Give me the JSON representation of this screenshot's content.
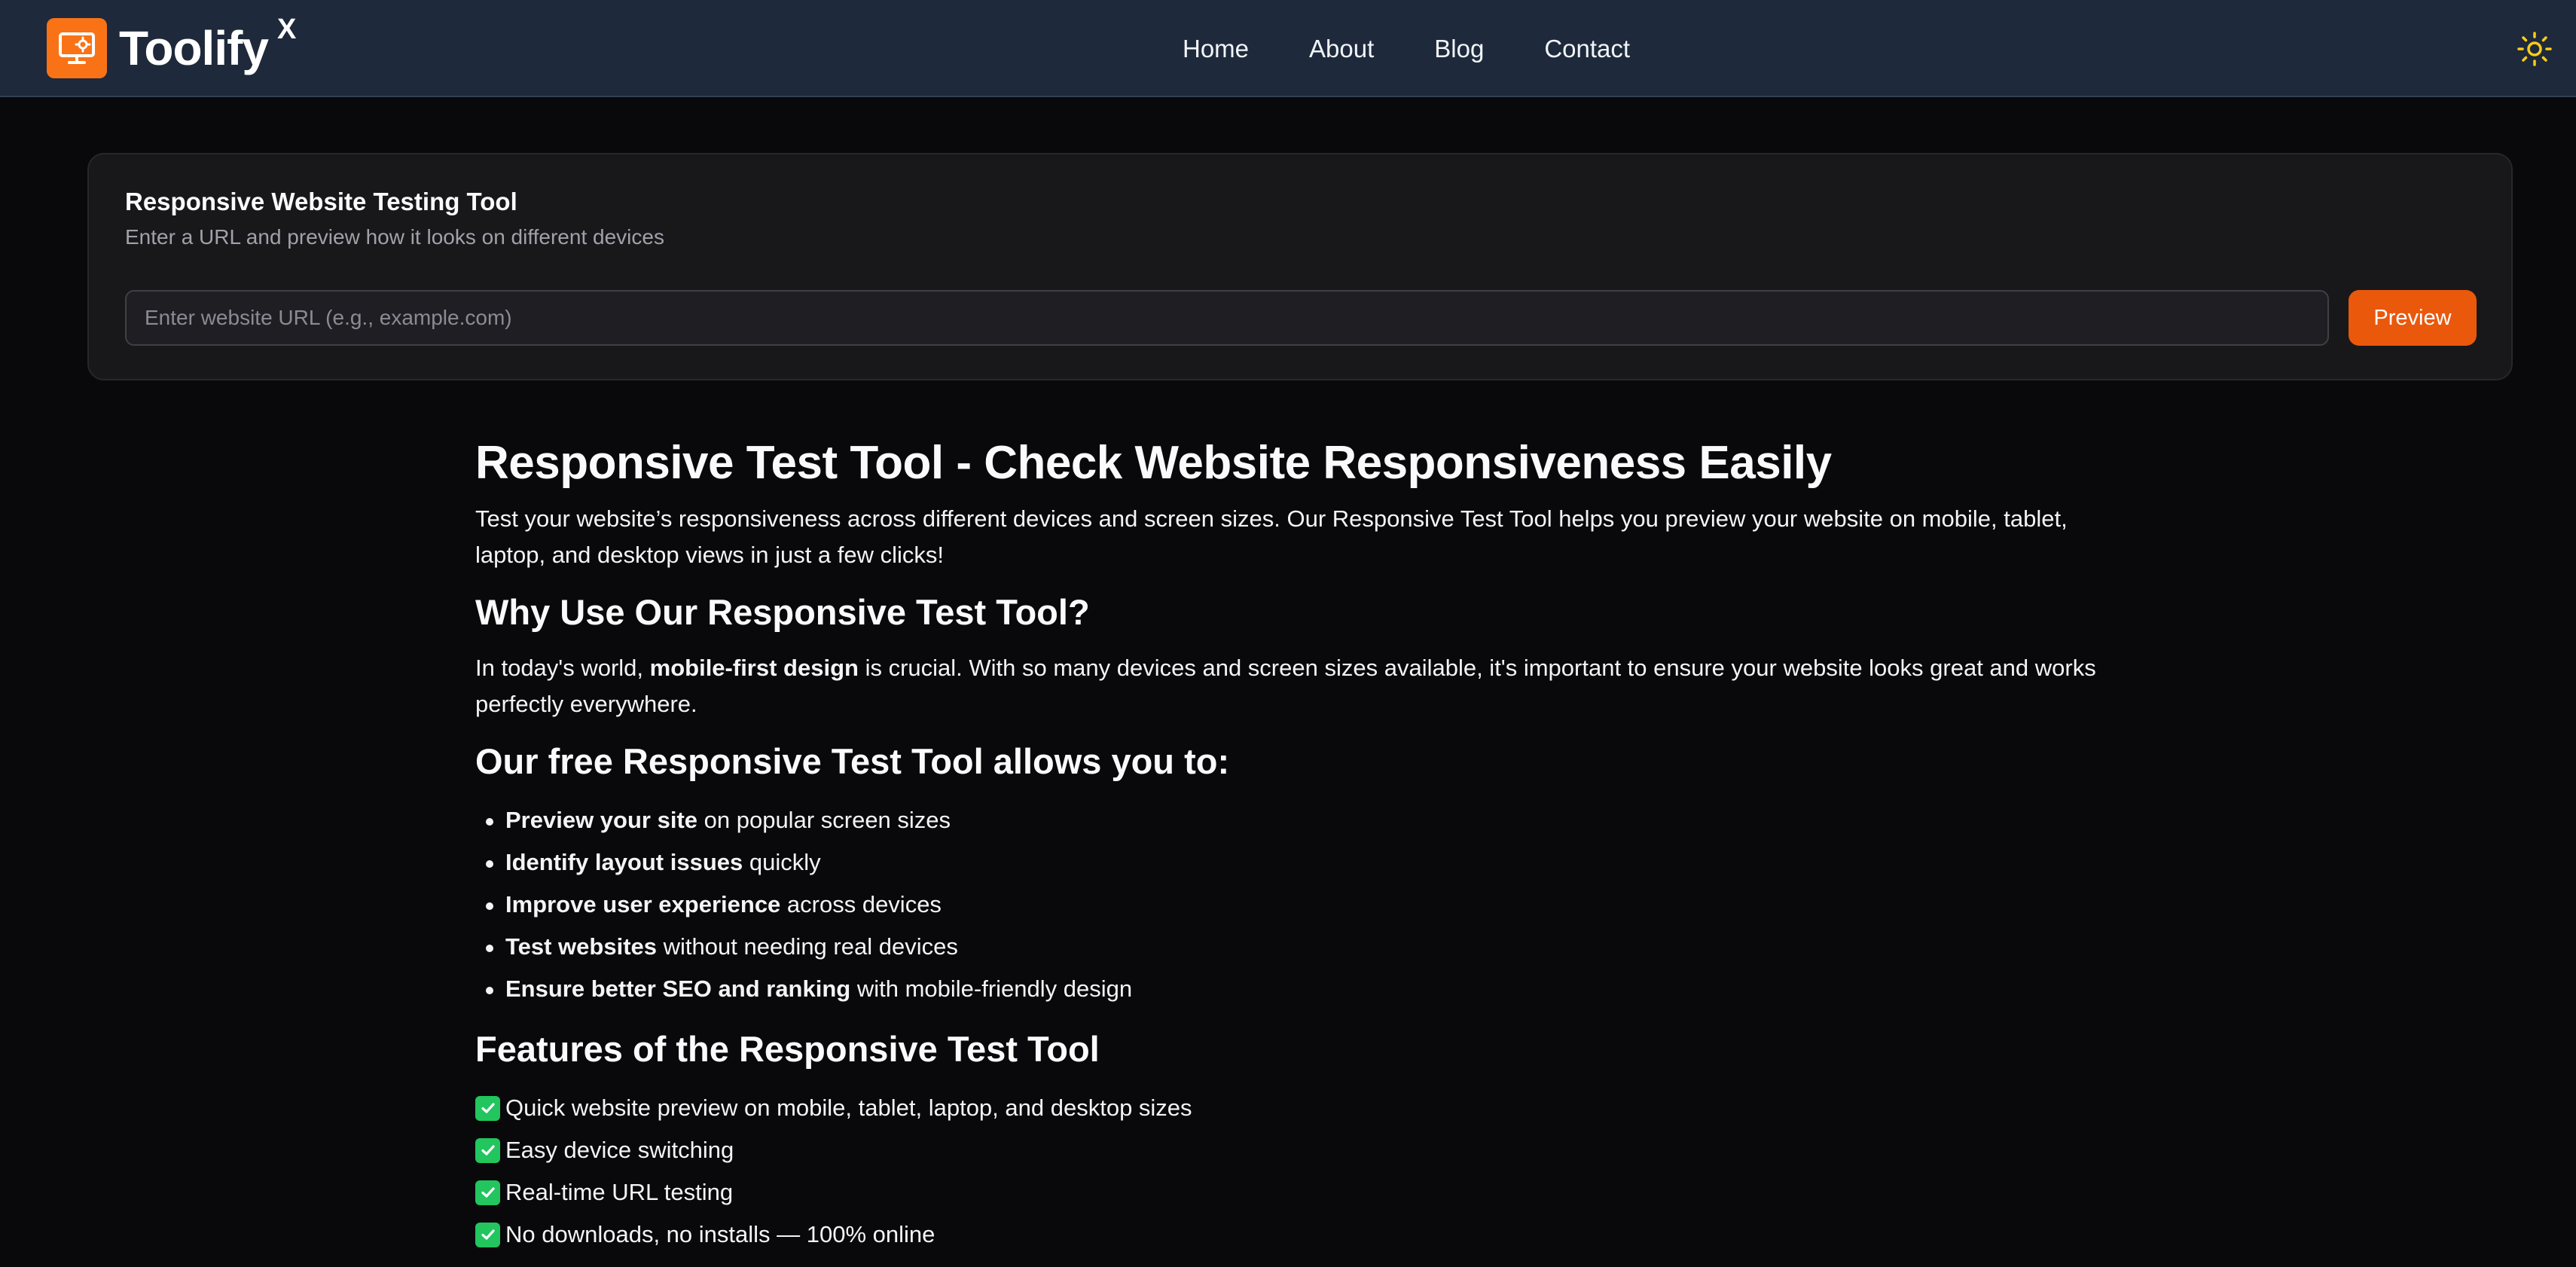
{
  "header": {
    "brand_name": "Toolify",
    "brand_sup": "X",
    "nav": [
      "Home",
      "About",
      "Blog",
      "Contact"
    ],
    "theme_icon": "sun-icon",
    "accent_color": "#f97316"
  },
  "tool": {
    "title": "Responsive Website Testing Tool",
    "subtitle": "Enter a URL and preview how it looks on different devices",
    "url_value": "",
    "url_placeholder": "Enter website URL (e.g., example.com)",
    "preview_label": "Preview",
    "button_color": "#ea580c"
  },
  "article": {
    "h1": "Responsive Test Tool - Check Website Responsiveness Easily",
    "intro": "Test your website’s responsiveness across different devices and screen sizes. Our Responsive Test Tool helps you preview your website on mobile, tablet, laptop, and desktop views in just a few clicks!",
    "why_heading": "Why Use Our Responsive Test Tool?",
    "why_pre": "In today's world, ",
    "why_bold": "mobile-first design",
    "why_post": " is crucial. With so many devices and screen sizes available, it's important to ensure your website looks great and works perfectly everywhere.",
    "allows_heading": "Our free Responsive Test Tool allows you to:",
    "benefits": [
      {
        "bold": "Preview your site",
        "text": " on popular screen sizes"
      },
      {
        "bold": "Identify layout issues",
        "text": " quickly"
      },
      {
        "bold": "Improve user experience",
        "text": " across devices"
      },
      {
        "bold": "Test websites",
        "text": " without needing real devices"
      },
      {
        "bold": "Ensure better SEO and ranking",
        "text": " with mobile-friendly design"
      }
    ],
    "features_heading": "Features of the Responsive Test Tool",
    "features": [
      "Quick website preview on mobile, tablet, laptop, and desktop sizes",
      "Easy device switching",
      "Real-time URL testing",
      "No downloads, no installs — 100% online"
    ],
    "check_icon": "check-box-icon"
  }
}
